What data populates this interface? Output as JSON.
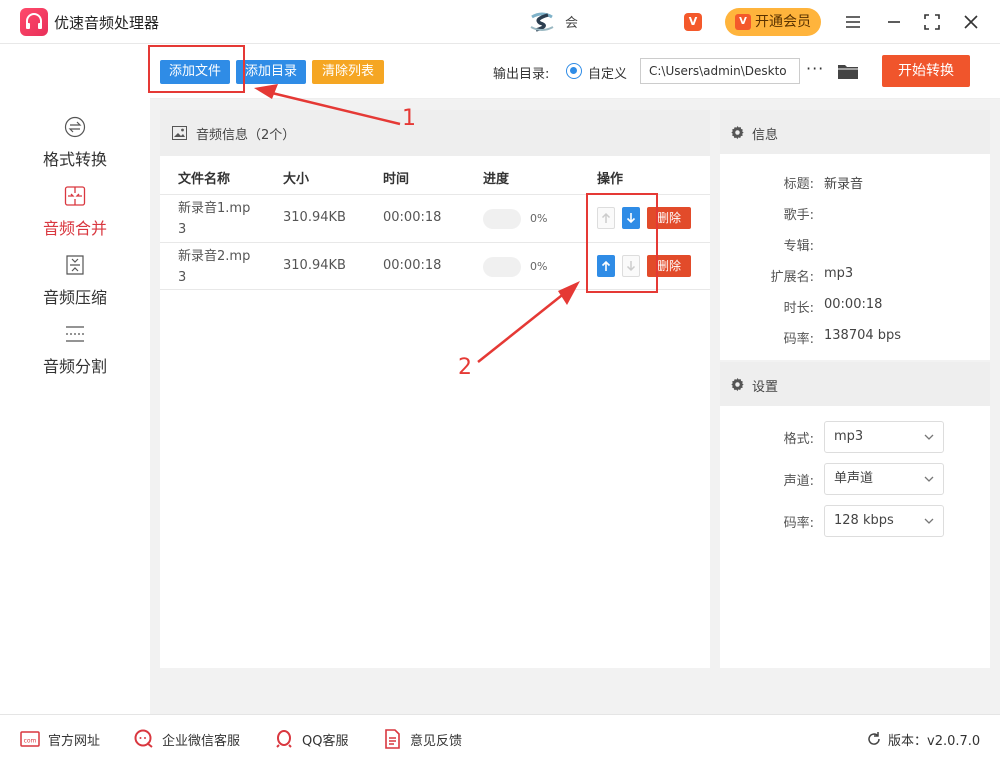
{
  "app": {
    "title": "优速音频处理器",
    "user_name": "会"
  },
  "titlebar": {
    "vip_label": "开通会员",
    "vip_mark": "V",
    "promo_mark": "V"
  },
  "sidebar": {
    "items": [
      {
        "label": "格式转换",
        "icon": "convert-icon",
        "active": false
      },
      {
        "label": "音频合并",
        "icon": "merge-icon",
        "active": true
      },
      {
        "label": "音频压缩",
        "icon": "compress-icon",
        "active": false
      },
      {
        "label": "音频分割",
        "icon": "split-icon",
        "active": false
      }
    ]
  },
  "toolbar": {
    "add_file": "添加文件",
    "add_dir": "添加目录",
    "clear_list": "清除列表",
    "output_label": "输出目录:",
    "custom_label": "自定义",
    "output_path": "C:\\Users\\admin\\Deskto",
    "more": "···",
    "start": "开始转换"
  },
  "audio_list": {
    "title": "音频信息（2个）",
    "columns": {
      "name": "文件名称",
      "size": "大小",
      "time": "时间",
      "progress": "进度",
      "action": "操作"
    },
    "rows": [
      {
        "name": "新录音1.mp3",
        "size": "310.94KB",
        "time": "00:00:18",
        "progress_pct": "0%",
        "progress": 0,
        "up_enabled": false,
        "down_enabled": true,
        "delete": "删除"
      },
      {
        "name": "新录音2.mp3",
        "size": "310.94KB",
        "time": "00:00:18",
        "progress_pct": "0%",
        "progress": 0,
        "up_enabled": true,
        "down_enabled": false,
        "delete": "删除"
      }
    ]
  },
  "info": {
    "title": "信息",
    "fields": [
      {
        "label": "标题:",
        "value": "新录音"
      },
      {
        "label": "歌手:",
        "value": ""
      },
      {
        "label": "专辑:",
        "value": ""
      },
      {
        "label": "扩展名:",
        "value": "mp3"
      },
      {
        "label": "时长:",
        "value": "00:00:18"
      },
      {
        "label": "码率:",
        "value": "138704 bps"
      }
    ]
  },
  "settings": {
    "title": "设置",
    "format": {
      "label": "格式:",
      "value": "mp3"
    },
    "channel": {
      "label": "声道:",
      "value": "单声道"
    },
    "bitrate": {
      "label": "码率:",
      "value": "128 kbps"
    }
  },
  "bottom": {
    "website": "官方网址",
    "wechat": "企业微信客服",
    "qq": "QQ客服",
    "feedback": "意见反馈",
    "version": "版本：v2.0.7.0"
  },
  "annotations": {
    "label_1": "1",
    "label_2": "2"
  },
  "colors": {
    "accent_blue": "#2f8ce6",
    "accent_red": "#e24b2a",
    "start_orange": "#f0552c",
    "clear_orange": "#f5a623",
    "active_nav": "#d9373f"
  }
}
